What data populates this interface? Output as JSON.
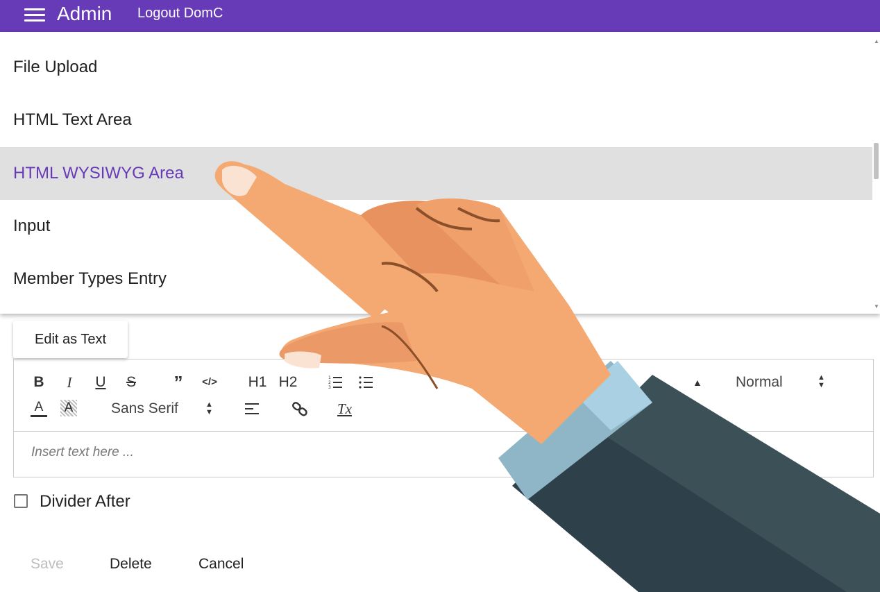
{
  "appbar": {
    "title": "Admin",
    "logout_label": "Logout DomC",
    "menu_icon": "hamburger-icon",
    "color": "#673ab7"
  },
  "dropdown": {
    "items": [
      {
        "label": "File Upload",
        "selected": false
      },
      {
        "label": "HTML Text Area",
        "selected": false
      },
      {
        "label": "HTML WYSIWYG Area",
        "selected": true
      },
      {
        "label": "Input",
        "selected": false
      },
      {
        "label": "Member Types Entry",
        "selected": false
      }
    ],
    "selected_color": "#673ab7",
    "selected_bg": "#e0e0e0"
  },
  "editor": {
    "edit_as_text_label": "Edit as Text",
    "toolbar": {
      "bold": "B",
      "italic": "I",
      "underline": "U",
      "strike": "S",
      "h1": "H1",
      "h2": "H2",
      "size_picker": "Normal",
      "font_picker": "Sans Serif",
      "clean": "Tx"
    },
    "placeholder": "Insert text here ..."
  },
  "divider_after": {
    "label": "Divider After",
    "checked": false
  },
  "actions": {
    "save_label": "Save",
    "delete_label": "Delete",
    "cancel_label": "Cancel",
    "save_disabled": true
  },
  "overlay": {
    "icon": "pointing-hand-illustration"
  }
}
